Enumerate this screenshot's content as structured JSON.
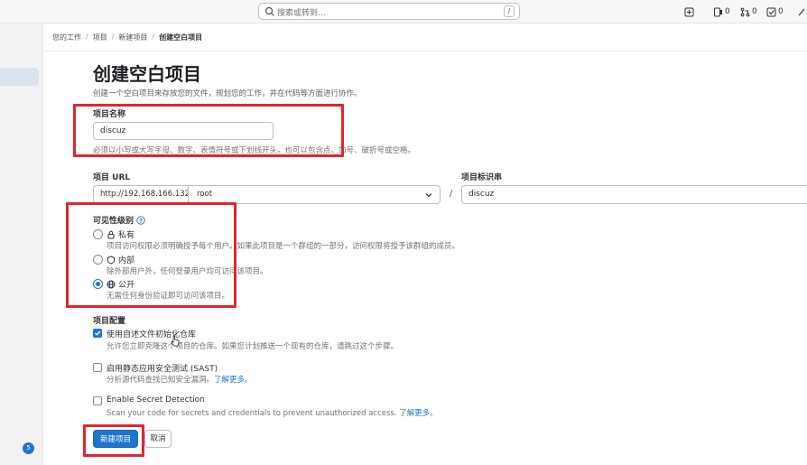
{
  "topbar": {
    "search_placeholder": "搜索或转到...",
    "search_shortcut": "/",
    "issues_count": "0",
    "mr_count": "0",
    "todo_count": "0"
  },
  "sidebar": {
    "badge": "5"
  },
  "breadcrumb": [
    "您的工作",
    "项目",
    "新建项目",
    "创建空白项目"
  ],
  "page": {
    "title": "创建空白项目",
    "description": "创建一个空白项目来存放您的文件，规划您的工作，并在代码等方面进行协作。"
  },
  "project_name": {
    "label": "项目名称",
    "value": "discuz",
    "hint": "必须以小写或大写字母、数字、表情符号或下划线开头。也可以包含点、加号、破折号或空格。"
  },
  "project_url": {
    "label": "项目 URL",
    "prefix": "http://192.168.166.132/",
    "namespace": "root",
    "separator": "/"
  },
  "project_slug": {
    "label": "项目标识串",
    "value": "discuz"
  },
  "visibility": {
    "label": "可见性级别",
    "options": [
      {
        "label": "私有",
        "desc": "项目访问权限必须明确授予每个用户。如果此项目是一个群组的一部分，访问权限将授予该群组的成员。",
        "icon": "lock-icon",
        "selected": false
      },
      {
        "label": "内部",
        "desc": "除外部用户外，任何登录用户均可访问该项目。",
        "icon": "shield-icon",
        "selected": false
      },
      {
        "label": "公开",
        "desc": "无需任何身份验证即可访问该项目。",
        "icon": "globe-icon",
        "selected": true
      }
    ]
  },
  "config": {
    "label": "项目配置",
    "items": [
      {
        "label": "使用自述文件初始化仓库",
        "desc": "允许您立即克隆这个项目的仓库。如果您计划推送一个现有的仓库，请跳过这个步骤。",
        "link": "",
        "checked": true
      },
      {
        "label": "启用静态应用安全测试 (SAST)",
        "desc": "分析源代码查找已知安全漏洞。",
        "link": "了解更多",
        "suffix": "。",
        "checked": false
      },
      {
        "label": "Enable Secret Detection",
        "desc": "Scan your code for secrets and credentials to prevent unauthorized access.",
        "link": "了解更多",
        "suffix": "。",
        "checked": false
      }
    ]
  },
  "actions": {
    "create": "新建项目",
    "cancel": "取消"
  },
  "colors": {
    "accent": "#1f75cb",
    "highlight": "#e0262f"
  }
}
